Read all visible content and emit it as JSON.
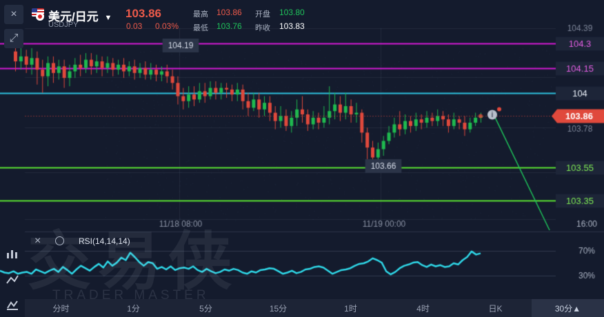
{
  "header": {
    "pair_name": "美元/日元",
    "pair_code": "USDJPY",
    "price": "103.86",
    "change": "0.03",
    "change_pct": "0.03%",
    "high_label": "最高",
    "high_value": "103.86",
    "open_label": "开盘",
    "open_value": "103.80",
    "low_label": "最低",
    "low_value": "103.76",
    "prev_label": "昨收",
    "prev_value": "103.83"
  },
  "chart_data": {
    "type": "candlestick",
    "price_scale_labels": [
      "104.39",
      "103.78",
      "16:00"
    ],
    "time_labels": [
      "11/18 08:00",
      "11/19 00:00"
    ],
    "horizontal_lines": [
      {
        "value": "104.3",
        "color": "#d31ad3"
      },
      {
        "value": "104.15",
        "color": "#d31ad3"
      },
      {
        "value": "104",
        "color": "#2ec3e0"
      },
      {
        "value": "103.55",
        "color": "#5ae032"
      },
      {
        "value": "103.35",
        "color": "#5ae032"
      }
    ],
    "current_price_tag": "103.86",
    "annotations": [
      "104.19",
      "103.66"
    ],
    "candles": [
      [
        104.25,
        104.19,
        104.3,
        104.13
      ],
      [
        104.19,
        104.22,
        104.28,
        104.14
      ],
      [
        104.22,
        104.17,
        104.26,
        104.12
      ],
      [
        104.17,
        104.21,
        104.27,
        104.11
      ],
      [
        104.21,
        104.14,
        104.25,
        104.05
      ],
      [
        104.14,
        104.1,
        104.2,
        104.0
      ],
      [
        104.1,
        104.18,
        104.22,
        104.04
      ],
      [
        104.18,
        104.12,
        104.22,
        104.06
      ],
      [
        104.12,
        104.16,
        104.2,
        104.08
      ],
      [
        104.16,
        104.09,
        104.2,
        104.03
      ],
      [
        104.09,
        104.13,
        104.17,
        104.04
      ],
      [
        104.13,
        104.17,
        104.21,
        104.09
      ],
      [
        104.17,
        104.15,
        104.23,
        104.1
      ],
      [
        104.15,
        104.2,
        104.24,
        104.12
      ],
      [
        104.2,
        104.16,
        104.24,
        104.11
      ],
      [
        104.16,
        104.19,
        104.23,
        104.12
      ],
      [
        104.19,
        104.15,
        104.22,
        104.1
      ],
      [
        104.15,
        104.18,
        104.22,
        104.12
      ],
      [
        104.18,
        104.14,
        104.21,
        104.1
      ],
      [
        104.14,
        104.17,
        104.2,
        104.11
      ],
      [
        104.17,
        104.13,
        104.21,
        104.09
      ],
      [
        104.13,
        104.16,
        104.19,
        104.1
      ],
      [
        104.16,
        104.12,
        104.2,
        104.08
      ],
      [
        104.12,
        104.15,
        104.18,
        104.09
      ],
      [
        104.15,
        104.11,
        104.19,
        104.08
      ],
      [
        104.11,
        104.14,
        104.18,
        104.08
      ],
      [
        104.14,
        104.11,
        104.17,
        104.07
      ],
      [
        104.11,
        104.13,
        104.16,
        104.07
      ],
      [
        104.13,
        104.1,
        104.17,
        104.06
      ],
      [
        104.1,
        104.06,
        104.14,
        104.02
      ],
      [
        104.06,
        103.98,
        104.1,
        103.93
      ],
      [
        103.98,
        103.95,
        104.03,
        103.9
      ],
      [
        103.95,
        103.99,
        104.04,
        103.91
      ],
      [
        103.99,
        103.96,
        104.04,
        103.92
      ],
      [
        103.96,
        104.01,
        104.06,
        103.94
      ],
      [
        104.01,
        103.98,
        104.06,
        103.94
      ],
      [
        103.98,
        104.03,
        104.07,
        103.96
      ],
      [
        104.03,
        104.0,
        104.07,
        103.96
      ],
      [
        104.0,
        104.03,
        104.06,
        103.96
      ],
      [
        104.03,
        104.02,
        104.06,
        103.97
      ],
      [
        104.02,
        103.99,
        104.05,
        103.95
      ],
      [
        103.99,
        104.02,
        104.06,
        103.95
      ],
      [
        104.02,
        103.95,
        104.05,
        103.9
      ],
      [
        103.95,
        103.91,
        104.0,
        103.86
      ],
      [
        103.91,
        103.96,
        104.0,
        103.89
      ],
      [
        103.96,
        103.9,
        104.0,
        103.85
      ],
      [
        103.9,
        103.94,
        103.98,
        103.86
      ],
      [
        103.94,
        103.88,
        103.98,
        103.83
      ],
      [
        103.88,
        103.83,
        103.92,
        103.78
      ],
      [
        103.83,
        103.86,
        103.92,
        103.79
      ],
      [
        103.86,
        103.8,
        103.9,
        103.77
      ],
      [
        103.8,
        103.85,
        103.89,
        103.76
      ],
      [
        103.85,
        103.9,
        103.96,
        103.8
      ],
      [
        103.9,
        103.87,
        103.98,
        103.82
      ],
      [
        103.87,
        103.81,
        103.9,
        103.77
      ],
      [
        103.81,
        103.85,
        103.89,
        103.78
      ],
      [
        103.85,
        103.82,
        103.88,
        103.78
      ],
      [
        103.82,
        103.85,
        103.92,
        103.79
      ],
      [
        103.85,
        103.89,
        104.04,
        103.81
      ],
      [
        103.89,
        103.93,
        104.0,
        103.84
      ],
      [
        103.93,
        103.88,
        103.98,
        103.83
      ],
      [
        103.88,
        103.92,
        104.0,
        103.84
      ],
      [
        103.92,
        103.87,
        103.96,
        103.82
      ],
      [
        103.87,
        103.88,
        103.94,
        103.82
      ],
      [
        103.88,
        103.76,
        103.9,
        103.7
      ],
      [
        103.76,
        103.67,
        103.79,
        103.6
      ],
      [
        103.67,
        103.61,
        103.71,
        103.57
      ],
      [
        103.61,
        103.66,
        103.7,
        103.58
      ],
      [
        103.66,
        103.71,
        103.74,
        103.62
      ],
      [
        103.71,
        103.76,
        103.8,
        103.69
      ],
      [
        103.76,
        103.81,
        103.85,
        103.73
      ],
      [
        103.81,
        103.78,
        103.89,
        103.74
      ],
      [
        103.78,
        103.83,
        103.87,
        103.75
      ],
      [
        103.83,
        103.8,
        103.86,
        103.76
      ],
      [
        103.8,
        103.84,
        103.88,
        103.77
      ],
      [
        103.84,
        103.82,
        103.87,
        103.78
      ],
      [
        103.82,
        103.85,
        103.89,
        103.79
      ],
      [
        103.85,
        103.83,
        103.88,
        103.8
      ],
      [
        103.83,
        103.86,
        103.9,
        103.8
      ],
      [
        103.86,
        103.84,
        103.89,
        103.8
      ],
      [
        103.84,
        103.8,
        103.87,
        103.76
      ],
      [
        103.8,
        103.84,
        103.88,
        103.78
      ],
      [
        103.84,
        103.82,
        103.86,
        103.78
      ],
      [
        103.82,
        103.78,
        103.86,
        103.74
      ],
      [
        103.78,
        103.82,
        103.85,
        103.76
      ],
      [
        103.82,
        103.85,
        103.88,
        103.8
      ],
      [
        103.85,
        103.86,
        103.88,
        103.82
      ]
    ],
    "projection": {
      "from": 103.86,
      "to": 103.23
    },
    "rsi": {
      "label": "RSI(14,14,14)",
      "levels": [
        "70%",
        "30%"
      ],
      "values": [
        38,
        35,
        34,
        37,
        33,
        35,
        36,
        33,
        40,
        37,
        34,
        38,
        41,
        36,
        44,
        39,
        33,
        40,
        46,
        42,
        38,
        44,
        49,
        43,
        53,
        46,
        51,
        59,
        55,
        67,
        60,
        52,
        46,
        52,
        50,
        41,
        44,
        40,
        45,
        39,
        42,
        43,
        41,
        45,
        39,
        36,
        41,
        37,
        34,
        36,
        40,
        38,
        41,
        39,
        35,
        33,
        37,
        35,
        39,
        40,
        42,
        41,
        37,
        33,
        35,
        38,
        34,
        36,
        40,
        41,
        44,
        45,
        43,
        38,
        33,
        36,
        39,
        40,
        42,
        46,
        49,
        50,
        53,
        58,
        55,
        51,
        37,
        32,
        36,
        42,
        46,
        48,
        51,
        52,
        47,
        44,
        48,
        45,
        47,
        44,
        45,
        50,
        48,
        55,
        60,
        69,
        64,
        66
      ]
    }
  },
  "sidebar": {
    "close_label": "×",
    "expand_label": "⤢"
  },
  "indicator_bar": {
    "close_label": "×",
    "name": "RSI(14,14,14)"
  },
  "watermark": {
    "title": "交易侠",
    "subtitle": "TRADER MASTER"
  },
  "timeframes": {
    "items": [
      "分时",
      "1分",
      "5分",
      "15分",
      "1时",
      "4时",
      "日K",
      "30分▲"
    ],
    "selected": "30分▲"
  }
}
